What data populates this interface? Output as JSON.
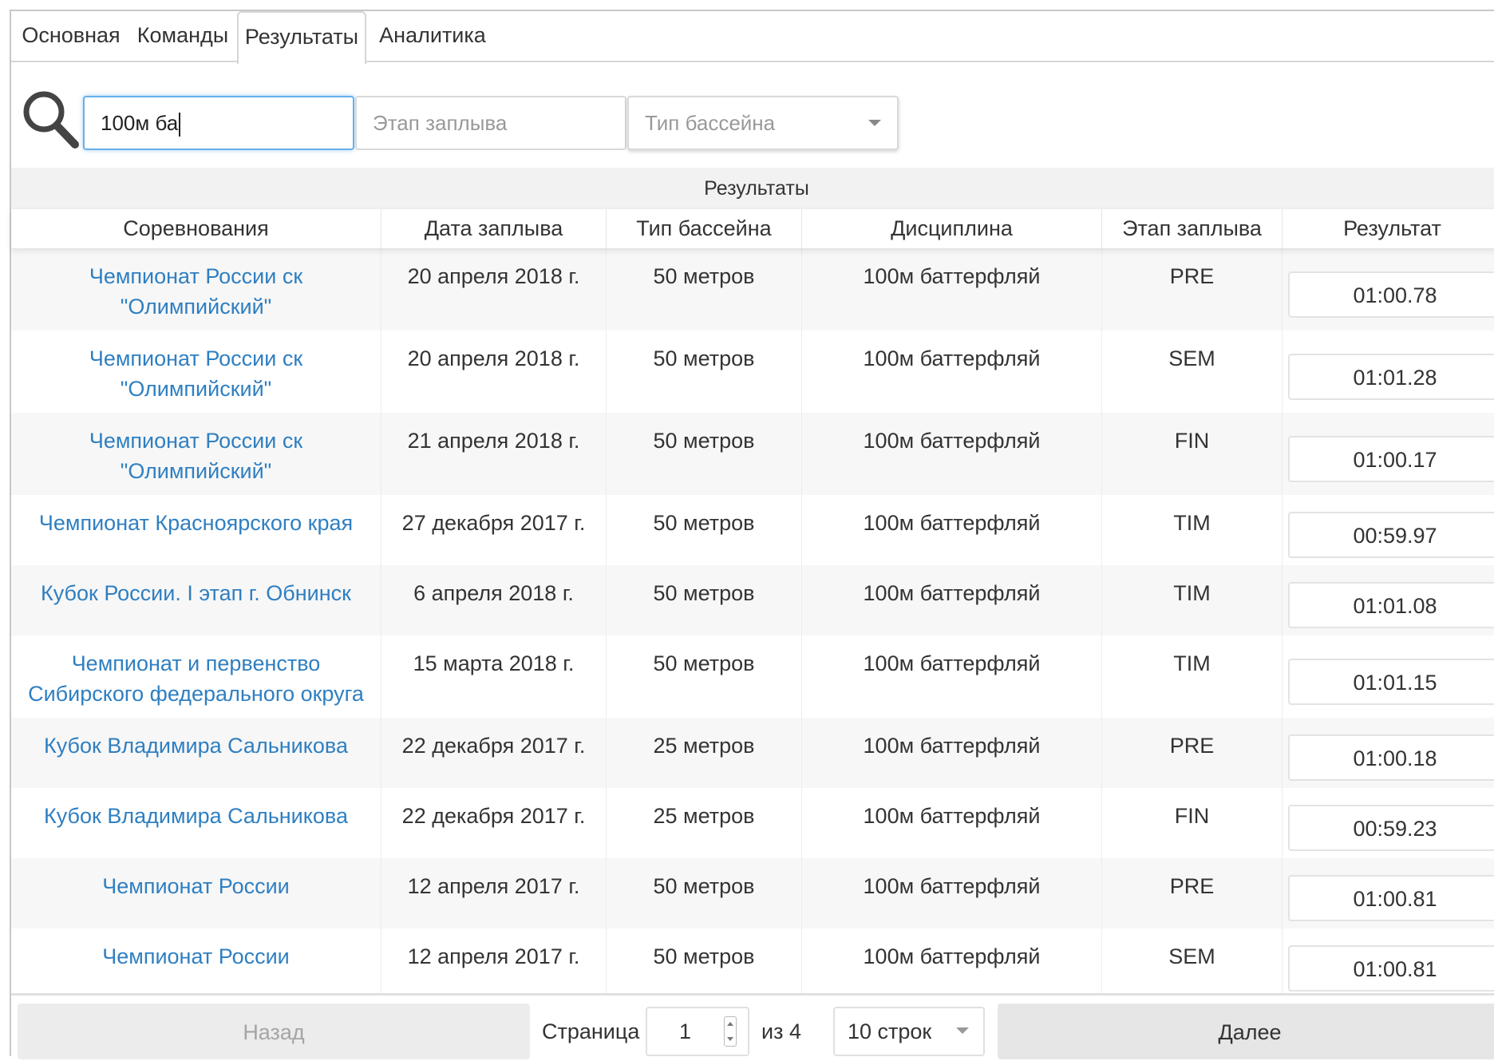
{
  "tabs": [
    {
      "label": "Основная"
    },
    {
      "label": "Команды"
    },
    {
      "label": "Результаты"
    },
    {
      "label": "Аналитика"
    }
  ],
  "active_tab": "Результаты",
  "filters": {
    "search_icon": "search-icon",
    "discipline_value": "100м ба",
    "stage_placeholder": "Этап заплыва",
    "pool_type_placeholder": "Тип бассейна"
  },
  "table": {
    "group_title": "Результаты",
    "columns": [
      "Соревнования",
      "Дата заплыва",
      "Тип бассейна",
      "Дисциплина",
      "Этап заплыва",
      "Результат"
    ],
    "rows": [
      {
        "competition": [
          "Чемпионат России ск",
          "\"Олимпийский\""
        ],
        "date": "20 апреля 2018 г.",
        "pool": "50 метров",
        "discipline": "100м баттерфляй",
        "stage": "PRE",
        "result": "01:00.78"
      },
      {
        "competition": [
          "Чемпионат России ск",
          "\"Олимпийский\""
        ],
        "date": "20 апреля 2018 г.",
        "pool": "50 метров",
        "discipline": "100м баттерфляй",
        "stage": "SEM",
        "result": "01:01.28"
      },
      {
        "competition": [
          "Чемпионат России ск",
          "\"Олимпийский\""
        ],
        "date": "21 апреля 2018 г.",
        "pool": "50 метров",
        "discipline": "100м баттерфляй",
        "stage": "FIN",
        "result": "01:00.17"
      },
      {
        "competition": [
          "Чемпионат Красноярского края"
        ],
        "date": "27 декабря 2017 г.",
        "pool": "50 метров",
        "discipline": "100м баттерфляй",
        "stage": "TIM",
        "result": "00:59.97"
      },
      {
        "competition": [
          "Кубок России. I этап г. Обнинск"
        ],
        "date": "6 апреля 2018 г.",
        "pool": "50 метров",
        "discipline": "100м баттерфляй",
        "stage": "TIM",
        "result": "01:01.08"
      },
      {
        "competition": [
          "Чемпионат и первенство",
          "Сибирского федерального округа"
        ],
        "date": "15 марта 2018 г.",
        "pool": "50 метров",
        "discipline": "100м баттерфляй",
        "stage": "TIM",
        "result": "01:01.15"
      },
      {
        "competition": [
          "Кубок Владимира Сальникова"
        ],
        "date": "22 декабря 2017 г.",
        "pool": "25 метров",
        "discipline": "100м баттерфляй",
        "stage": "PRE",
        "result": "01:00.18"
      },
      {
        "competition": [
          "Кубок Владимира Сальникова"
        ],
        "date": "22 декабря 2017 г.",
        "pool": "25 метров",
        "discipline": "100м баттерфляй",
        "stage": "FIN",
        "result": "00:59.23"
      },
      {
        "competition": [
          "Чемпионат России"
        ],
        "date": "12 апреля 2017 г.",
        "pool": "50 метров",
        "discipline": "100м баттерфляй",
        "stage": "PRE",
        "result": "01:00.81"
      },
      {
        "competition": [
          "Чемпионат России"
        ],
        "date": "12 апреля 2017 г.",
        "pool": "50 метров",
        "discipline": "100м баттерфляй",
        "stage": "SEM",
        "result": "01:00.81"
      }
    ]
  },
  "pagination": {
    "prev_label": "Назад",
    "page_label": "Страница",
    "page_value": "1",
    "of_label": "из 4",
    "rows_label": "10 строк",
    "next_label": "Далее"
  },
  "colors": {
    "link": "#2f7fc1",
    "focus": "#66afe9",
    "row_stripe": "#f7f7f7"
  }
}
